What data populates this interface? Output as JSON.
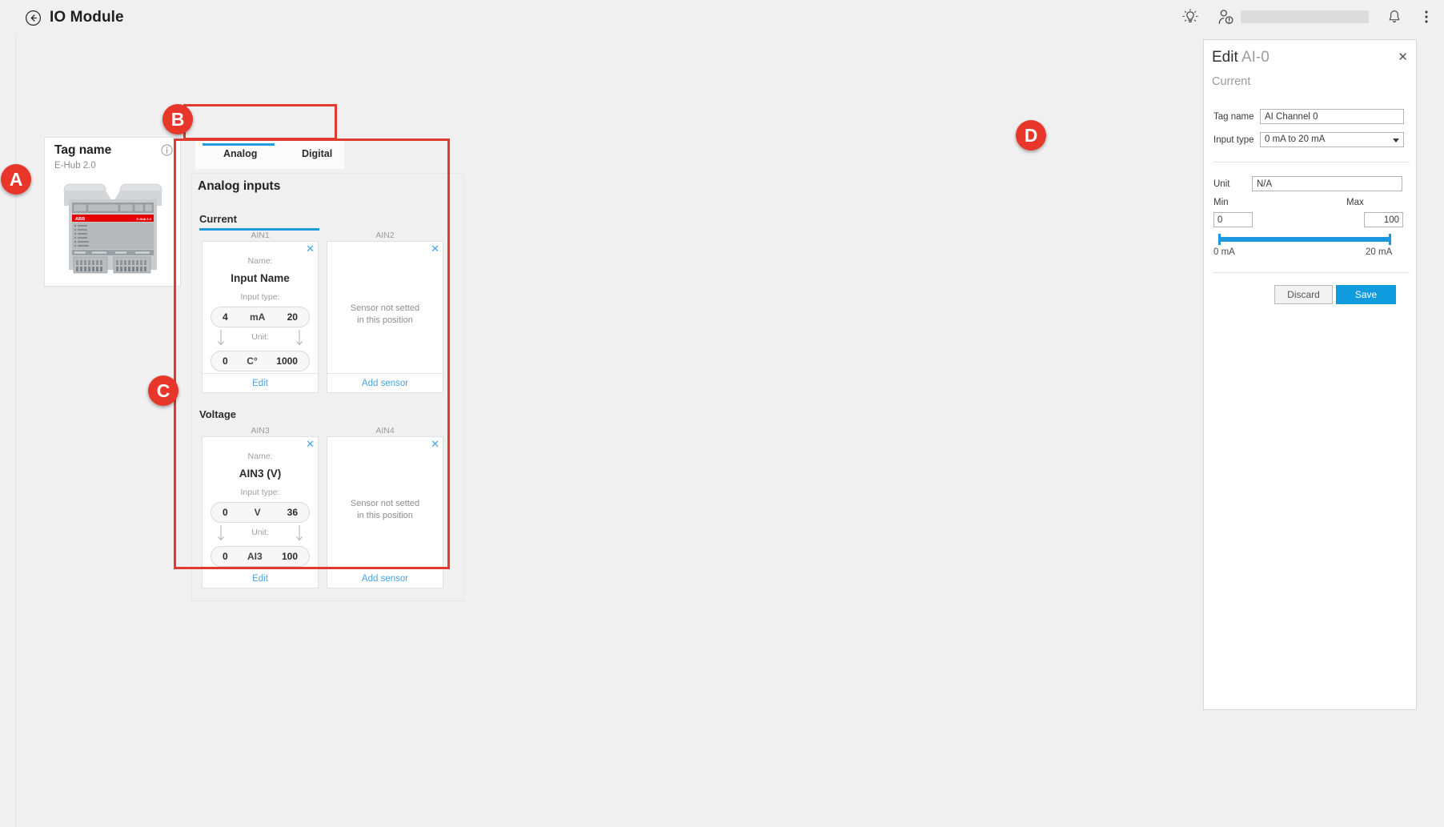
{
  "topbar": {
    "title": "IO Module",
    "back_icon": "back-arrow-circle-icon",
    "bulb_icon": "lightbulb-icon",
    "user_icon": "user-alert-icon",
    "bell_icon": "notification-bell-icon",
    "menu_icon": "more-vertical-icon"
  },
  "device_card": {
    "tag_name": "Tag name",
    "model": "E-Hub 2.0",
    "info_icon": "info-circle-icon",
    "brand_text": "ABB",
    "device_label": "E-Hub 2.0"
  },
  "tabs": {
    "items": [
      {
        "label": "Analog",
        "active": true
      },
      {
        "label": "Digital",
        "active": false
      }
    ]
  },
  "analog_panel": {
    "title": "Analog inputs",
    "groups": [
      {
        "name": "Current",
        "channels": [
          {
            "id": "AIN1",
            "configured": true,
            "name_label": "Name:",
            "name_value": "Input Name",
            "input_type_label": "Input type:",
            "input_min": "4",
            "input_unit": "mA",
            "input_max": "20",
            "unit_label": "Unit:",
            "unit_min": "0",
            "unit_symbol": "C°",
            "unit_max": "1000",
            "footer_link": "Edit",
            "close_icon": "close-icon"
          },
          {
            "id": "AIN2",
            "configured": false,
            "empty_line1": "Sensor not setted",
            "empty_line2": "in this position",
            "footer_link": "Add sensor",
            "close_icon": "close-icon"
          }
        ]
      },
      {
        "name": "Voltage",
        "channels": [
          {
            "id": "AIN3",
            "configured": true,
            "name_label": "Name:",
            "name_value": "AIN3 (V)",
            "input_type_label": "Input type:",
            "input_min": "0",
            "input_unit": "V",
            "input_max": "36",
            "unit_label": "Unit:",
            "unit_min": "0",
            "unit_symbol": "AI3",
            "unit_max": "100",
            "footer_link": "Edit",
            "close_icon": "close-icon"
          },
          {
            "id": "AIN4",
            "configured": false,
            "empty_line1": "Sensor not setted",
            "empty_line2": "in this position",
            "footer_link": "Add sensor",
            "close_icon": "close-icon"
          }
        ]
      }
    ]
  },
  "callouts": [
    {
      "letter": "A"
    },
    {
      "letter": "B"
    },
    {
      "letter": "C"
    },
    {
      "letter": "D"
    }
  ],
  "edit_panel": {
    "title_bold": "Edit",
    "title_light": "AI-0",
    "subtitle": "Current",
    "close_icon": "close-icon",
    "tag_name_label": "Tag name",
    "tag_name_value": "AI Channel 0",
    "input_type_label": "Input type",
    "input_type_value": "0 mA to 20 mA",
    "input_type_caret": "chevron-down-icon",
    "unit_label": "Unit",
    "unit_value": "N/A",
    "min_label": "Min",
    "min_value": "0",
    "max_label": "Max",
    "max_value": "100",
    "slider_min_tick": "0 mA",
    "slider_max_tick": "20 mA",
    "discard_label": "Discard",
    "save_label": "Save"
  },
  "colors": {
    "accent_blue": "#1f9bde",
    "link_blue": "#4aa3dc",
    "save_blue": "#109bdf",
    "highlight_red": "#e03b30",
    "badge_red": "#e8362a",
    "brand_red": "#e60000"
  }
}
